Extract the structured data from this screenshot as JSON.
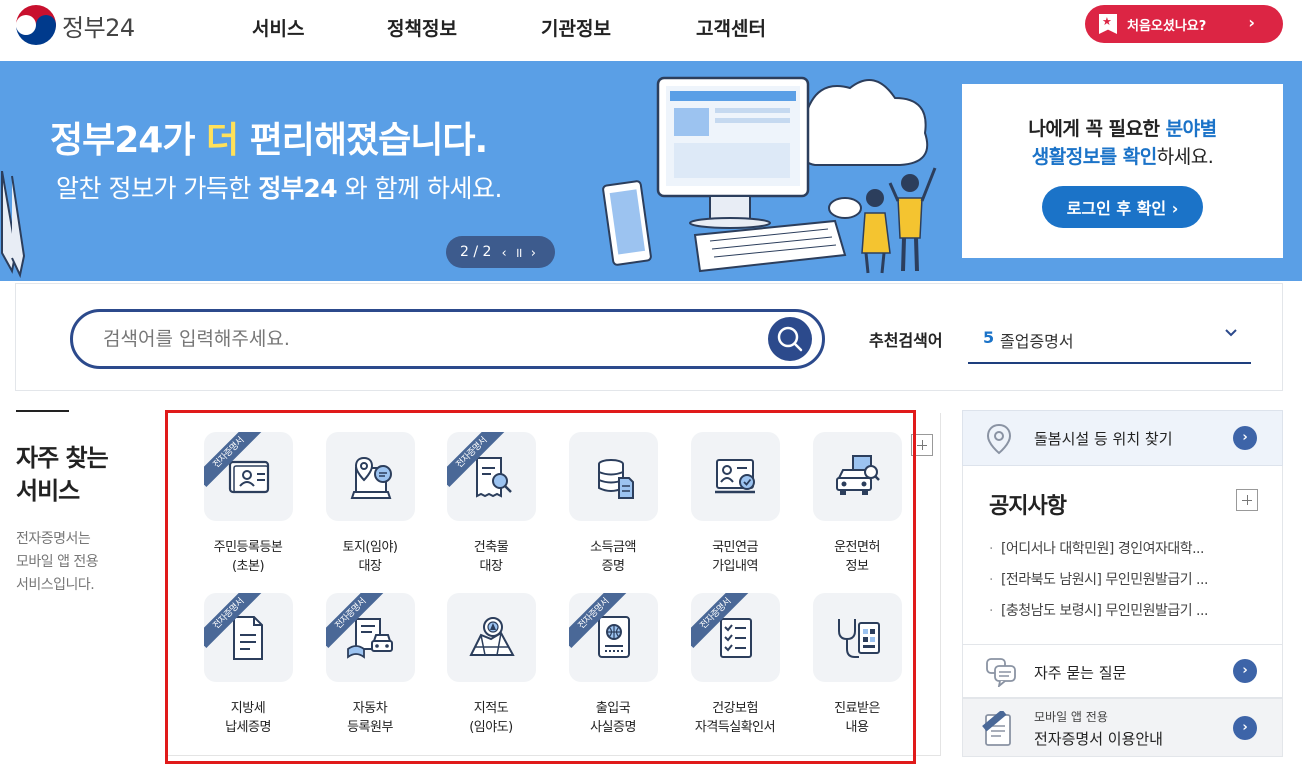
{
  "header": {
    "logo_text": "정부24",
    "nav": [
      "서비스",
      "정책정보",
      "기관정보",
      "고객센터"
    ],
    "first_visit_label": "처음오셨나요?",
    "first_visit_chevron": "›"
  },
  "banner": {
    "title_part1": "정부24가 ",
    "title_highlight": "더",
    "title_part2": " 편리해졌습니다.",
    "subtitle_part1": "알찬 정보가 가득한 ",
    "subtitle_bold": "정부24",
    "subtitle_part2": " 와 함께 하세요.",
    "pager_text": "2 / 2",
    "pager_controls": "‹ ॥ ›"
  },
  "login_card": {
    "line1_normal": "나에게 꼭 필요한 ",
    "line1_blue": "분야별",
    "line2_blue": "생활정보를 확인",
    "line2_normal": "하세요.",
    "button_label": "로그인 후 확인 ›"
  },
  "search": {
    "placeholder": "검색어를 입력해주세요.",
    "recommend_label": "추천검색어",
    "recommend_number": "5",
    "recommend_text": "졸업증명서"
  },
  "favorites": {
    "title_line1": "자주 찾는",
    "title_line2": "서비스",
    "desc_line1": "전자증명서는",
    "desc_line2": "모바일 앱 전용",
    "desc_line3": "서비스입니다.",
    "ribbon_text": "전자증명서",
    "items": [
      {
        "line1": "주민등록등본",
        "line2": "(초본)",
        "ribbon": true,
        "icon": "id-card-icon"
      },
      {
        "line1": "토지(임야)",
        "line2": "대장",
        "ribbon": false,
        "icon": "land-map-icon"
      },
      {
        "line1": "건축물",
        "line2": "대장",
        "ribbon": true,
        "icon": "building-doc-icon"
      },
      {
        "line1": "소득금액",
        "line2": "증명",
        "ribbon": false,
        "icon": "coins-icon"
      },
      {
        "line1": "국민연금",
        "line2": "가입내역",
        "ribbon": false,
        "icon": "pension-icon"
      },
      {
        "line1": "운전면허",
        "line2": "정보",
        "ribbon": false,
        "icon": "car-license-icon"
      },
      {
        "line1": "지방세",
        "line2": "납세증명",
        "ribbon": true,
        "icon": "tax-doc-icon"
      },
      {
        "line1": "자동차",
        "line2": "등록원부",
        "ribbon": true,
        "icon": "car-register-icon"
      },
      {
        "line1": "지적도",
        "line2": "(임야도)",
        "ribbon": false,
        "icon": "cadastral-map-icon"
      },
      {
        "line1": "출입국",
        "line2": "사실증명",
        "ribbon": true,
        "icon": "passport-icon"
      },
      {
        "line1": "건강보험",
        "line2": "자격득실확인서",
        "ribbon": true,
        "icon": "checklist-icon"
      },
      {
        "line1": "진료받은",
        "line2": "내용",
        "ribbon": false,
        "icon": "stethoscope-icon"
      }
    ]
  },
  "right": {
    "care_text": "돌봄시설 등 위치 찾기",
    "notice_title": "공지사항",
    "notices": [
      "[어디서나 대학민원] 경인여자대학...",
      "[전라북도 남원시] 무인민원발급기 ...",
      "[충청남도 보령시] 무인민원발급기 ..."
    ],
    "faq_text": "자주 묻는 질문",
    "mobile_sub": "모바일 앱 전용",
    "mobile_main": "전자증명서 이용안내",
    "go_symbol": "›"
  },
  "colors": {
    "brand_red": "#dc2544",
    "banner_blue": "#5a9fe6",
    "accent_blue": "#1b73c8",
    "navy": "#2c4a8c",
    "highlight_frame": "#e01a1a"
  }
}
